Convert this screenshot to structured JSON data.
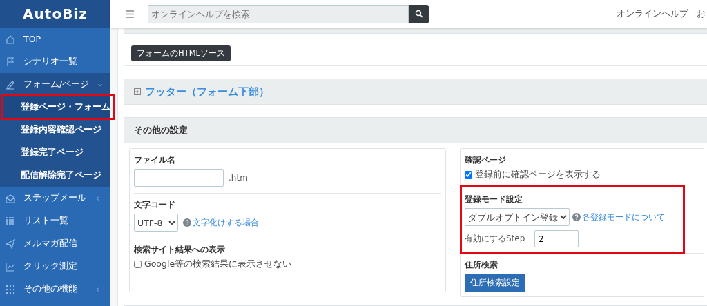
{
  "sidebar": {
    "logo": "AutoBiz",
    "items": [
      {
        "label": "TOP",
        "has_submenu": false,
        "expanded": false
      },
      {
        "label": "シナリオ一覧",
        "has_submenu": false,
        "expanded": false
      },
      {
        "label": "フォーム/ページ",
        "has_submenu": true,
        "expanded": true,
        "children": [
          {
            "label": "登録ページ・フォーム",
            "selected": true,
            "highlighted": true
          },
          {
            "label": "登録内容確認ページ",
            "selected": false,
            "highlighted": false
          },
          {
            "label": "登録完了ページ",
            "selected": false,
            "highlighted": false
          },
          {
            "label": "配信解除完了ページ",
            "selected": false,
            "highlighted": false
          }
        ]
      },
      {
        "label": "ステップメール",
        "has_submenu": true,
        "expanded": false
      },
      {
        "label": "リスト一覧",
        "has_submenu": false,
        "expanded": false
      },
      {
        "label": "メルマガ配信",
        "has_submenu": false,
        "expanded": false
      },
      {
        "label": "クリック測定",
        "has_submenu": false,
        "expanded": false
      },
      {
        "label": "その他の機能",
        "has_submenu": true,
        "expanded": false
      }
    ]
  },
  "header": {
    "search": {
      "placeholder": "オンラインヘルプを検索"
    },
    "links": [
      "オンラインヘルプ",
      "お"
    ]
  },
  "html_source_button": "フォームのHTMLソース",
  "footer_section": {
    "title": "フッター（フォーム下部）",
    "expanded": false
  },
  "other_settings": {
    "title": "その他の設定",
    "file_name": {
      "label": "ファイル名",
      "suffix": ".htm"
    },
    "charset": {
      "label": "文字コード",
      "value": "UTF-8",
      "help": "文字化けする場合"
    },
    "search_display": {
      "label": "検索サイト結果への表示",
      "option": "Google等の検索結果に表示させない",
      "checked": false
    },
    "confirm_page": {
      "label": "確認ページ",
      "option": "登録前に確認ページを表示する",
      "checked": true
    },
    "register_mode": {
      "label": "登録モード設定",
      "value": "ダブルオプトイン登録",
      "help": "各登録モードについて",
      "step_label": "有効にするStep",
      "step_value": "2",
      "highlighted": true
    },
    "address_search": {
      "label": "住所検索",
      "button": "住所検索設定"
    }
  }
}
